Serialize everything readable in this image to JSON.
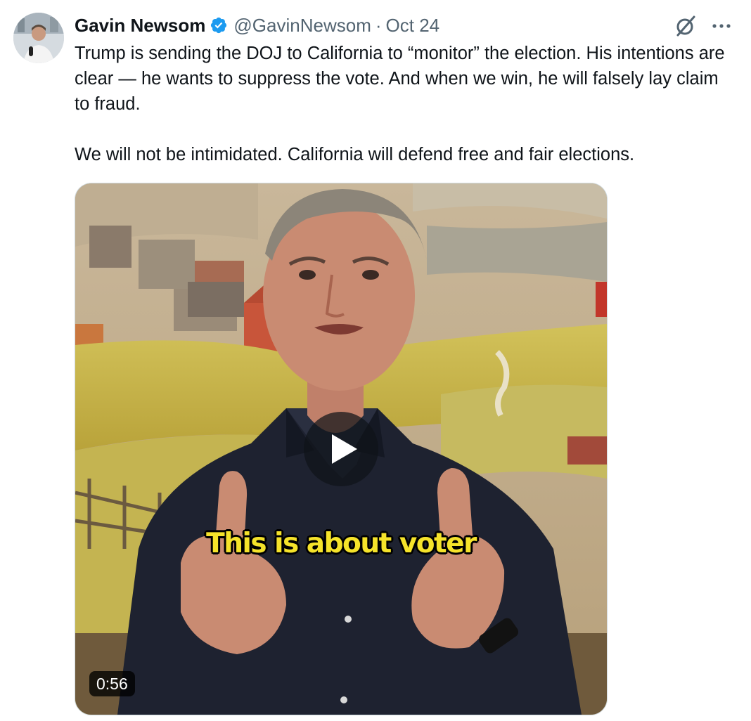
{
  "tweet": {
    "author_name": "Gavin Newsom",
    "handle": "@GavinNewsom",
    "separator": "·",
    "date": "Oct 24",
    "text_paragraphs": [
      "Trump is sending the DOJ to California to “monitor” the election. His intentions are clear —  he wants to suppress the vote. And when we win, he will falsely lay claim to fraud.",
      "We will not be intimidated. California will defend free and fair elections."
    ]
  },
  "media": {
    "caption": "This is about voter",
    "duration": "0:56"
  },
  "icons": {
    "verified": "verified-badge-icon",
    "grok": "grok-icon",
    "more": "more-options-icon",
    "play": "play-icon"
  },
  "colors": {
    "verified_blue": "#1d9bf0",
    "secondary_text": "#536471",
    "caption_yellow": "#f5e32a"
  }
}
